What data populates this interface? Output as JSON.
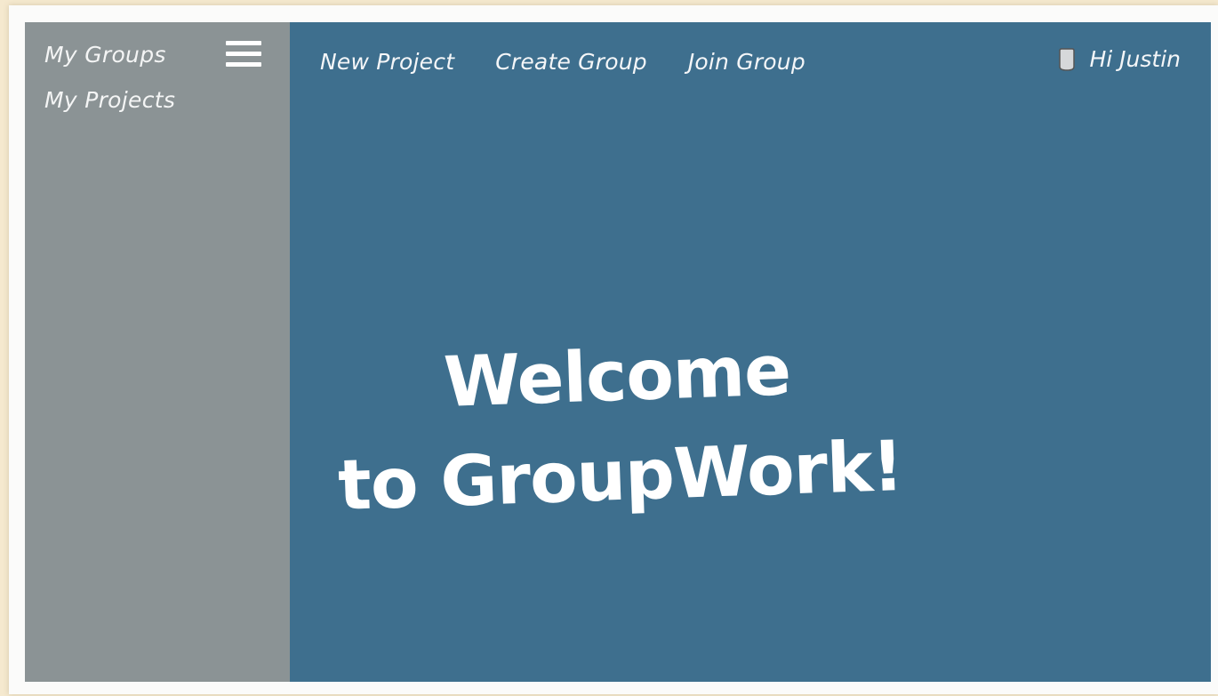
{
  "sidebar": {
    "items": [
      {
        "label": "My Groups"
      },
      {
        "label": "My Projects"
      }
    ],
    "menu_icon": "hamburger-menu-icon"
  },
  "header": {
    "nav": [
      {
        "label": "New Project"
      },
      {
        "label": "Create Group"
      },
      {
        "label": "Join Group"
      }
    ],
    "user": {
      "icon": "user-avatar-icon",
      "greeting": "Hi Justin"
    }
  },
  "main": {
    "welcome_line1": "Welcome",
    "welcome_line2": "to GroupWork!"
  },
  "colors": {
    "sidebar_bg": "#8b9395",
    "main_bg": "#3e6f8e",
    "text": "#ffffff"
  }
}
